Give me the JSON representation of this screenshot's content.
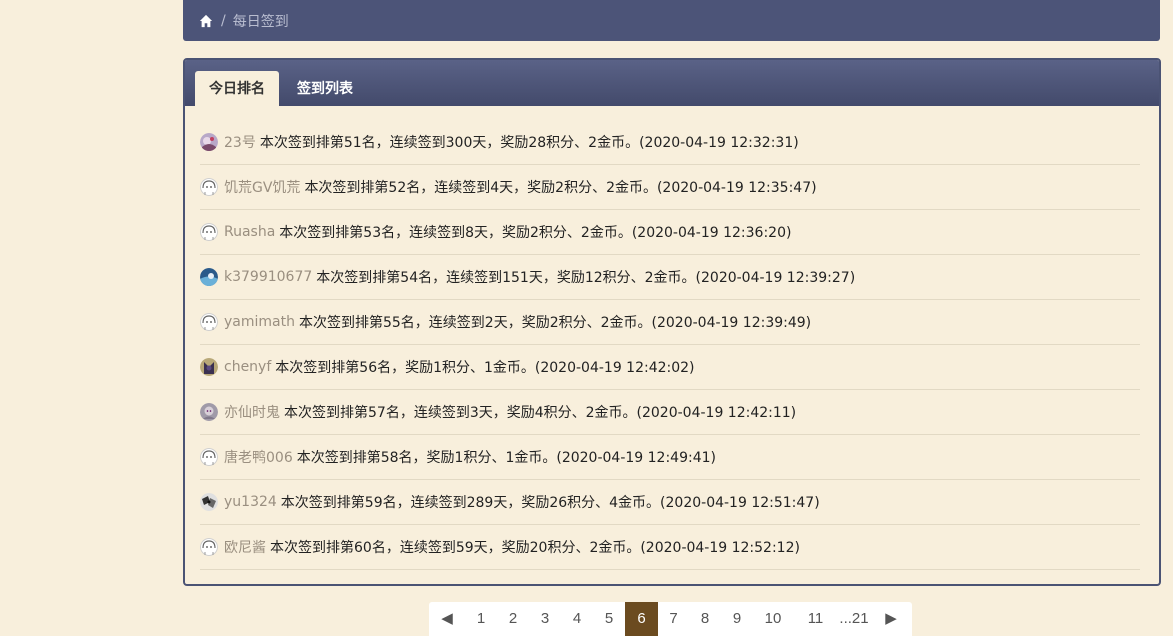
{
  "breadcrumb": {
    "home_icon": "home-icon",
    "separator": "/",
    "current": "每日签到"
  },
  "tabs": [
    {
      "label": "今日排名",
      "active": true
    },
    {
      "label": "签到列表",
      "active": false
    }
  ],
  "rows": [
    {
      "user": "23号",
      "text": "本次签到排第51名，连续签到300天，奖励28积分、2金币。(2020-04-19 12:32:31)",
      "avatar": "photo-avatar-purple"
    },
    {
      "user": "饥荒GV饥荒",
      "text": "本次签到排第52名，连续签到4天，奖励2积分、2金币。(2020-04-19 12:35:47)",
      "avatar": "default-avatar"
    },
    {
      "user": "Ruasha",
      "text": "本次签到排第53名，连续签到8天，奖励2积分、2金币。(2020-04-19 12:36:20)",
      "avatar": "default-avatar"
    },
    {
      "user": "k379910677",
      "text": "本次签到排第54名，连续签到151天，奖励12积分、2金币。(2020-04-19 12:39:27)",
      "avatar": "photo-avatar-blue"
    },
    {
      "user": "yamimath",
      "text": "本次签到排第55名，连续签到2天，奖励2积分、2金币。(2020-04-19 12:39:49)",
      "avatar": "default-avatar"
    },
    {
      "user": "chenyf",
      "text": "本次签到排第56名，奖励1积分、1金币。(2020-04-19 12:42:02)",
      "avatar": "photo-avatar-dark"
    },
    {
      "user": "亦仙时鬼",
      "text": "本次签到排第57名，连续签到3天，奖励4积分、2金币。(2020-04-19 12:42:11)",
      "avatar": "photo-avatar-grey"
    },
    {
      "user": "唐老鸭006",
      "text": "本次签到排第58名，奖励1积分、1金币。(2020-04-19 12:49:41)",
      "avatar": "default-avatar"
    },
    {
      "user": "yu1324",
      "text": "本次签到排第59名，连续签到289天，奖励26积分、4金币。(2020-04-19 12:51:47)",
      "avatar": "photo-avatar-bw"
    },
    {
      "user": "欧尼酱",
      "text": "本次签到排第60名，连续签到59天，奖励20积分、2金币。(2020-04-19 12:52:12)",
      "avatar": "default-avatar"
    }
  ],
  "pagination": {
    "prev": "◀",
    "pages": [
      "1",
      "2",
      "3",
      "4",
      "5",
      "6",
      "7",
      "8",
      "9",
      "10",
      "11",
      "...21"
    ],
    "current": "6",
    "next": "▶"
  },
  "colors": {
    "background": "#f8efdc",
    "header": "#4c5478",
    "active_page": "#6b4b20",
    "username": "#9a8f80"
  }
}
